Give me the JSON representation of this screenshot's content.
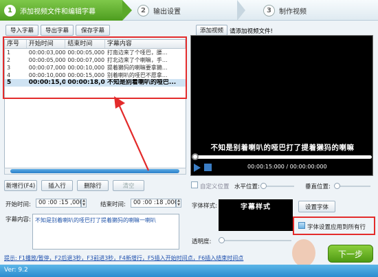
{
  "steps": [
    {
      "num": "1",
      "label": "添加视频文件和编辑字幕"
    },
    {
      "num": "2",
      "label": "输出设置"
    },
    {
      "num": "3",
      "label": "制作视频"
    }
  ],
  "toolbar": {
    "import_subtitle": "导入字幕",
    "export_subtitle": "导出字幕",
    "save_subtitle": "保存字幕",
    "add_video": "添加视频",
    "add_video_prompt": "请添加视频文件!"
  },
  "table": {
    "columns": [
      "序号",
      "开始时间",
      "结束时间",
      "字幕内容"
    ],
    "rows": [
      {
        "no": "1",
        "start": "00:00:03,000",
        "end": "00:00:05,000",
        "text": "打南边来了个哑巴，腰..."
      },
      {
        "no": "2",
        "start": "00:00:05,000",
        "end": "00:00:07,000",
        "text": "打北边来了个喇嘛，手..."
      },
      {
        "no": "3",
        "start": "00:00:07,000",
        "end": "00:00:10,000",
        "text": "提着獭犸的喇嘛要拿獭..."
      },
      {
        "no": "4",
        "start": "00:00:10,000",
        "end": "00:00:15,000",
        "text": "别着喇叭的哑巴不愿拿..."
      },
      {
        "no": "5",
        "start": "00:00:15,000",
        "end": "00:00:18,000",
        "text": "不知是别着喇叭的哑巴..."
      }
    ]
  },
  "row_actions": {
    "new_row": "新增行(F4)",
    "insert_row": "插入行",
    "delete_row": "删除行",
    "clear": "清空"
  },
  "editor": {
    "start_label": "开始时间:",
    "start_value": "00 :00 :15 ,000",
    "end_label": "结束时间:",
    "end_value": "00 :00 :18 ,000",
    "content_label": "字幕内容:",
    "content_value": "不知是别着喇叭的哑巴打了提着獭犸的喇嘛一喇叭"
  },
  "player": {
    "subtitle_overlay": "不知是别着喇叭的哑巴打了提着獭犸的喇嘛",
    "timecode": "00:00:15:000 / 00:00:00:000"
  },
  "settings": {
    "custom_position": "自定义位置",
    "horizontal_label": "水平位置:",
    "vertical_label": "垂直位置:",
    "font_style_label": "字体样式:",
    "font_style_preview": "字幕样式",
    "set_font": "设置字体",
    "apply_all": "字体设置应用到所有行",
    "opacity_label": "透明度:"
  },
  "hint": "提示: F1播放/暂停，F2后退3秒，F3前进3秒，F4新增行，F5插入开始时间点，F6插入结束时间点",
  "next_button": "下一步",
  "version": "Ver: 9.2",
  "colors": {
    "accent_green": "#5aa828",
    "highlight_red": "#e32b2b",
    "footer_blue": "#2d8ccf"
  }
}
